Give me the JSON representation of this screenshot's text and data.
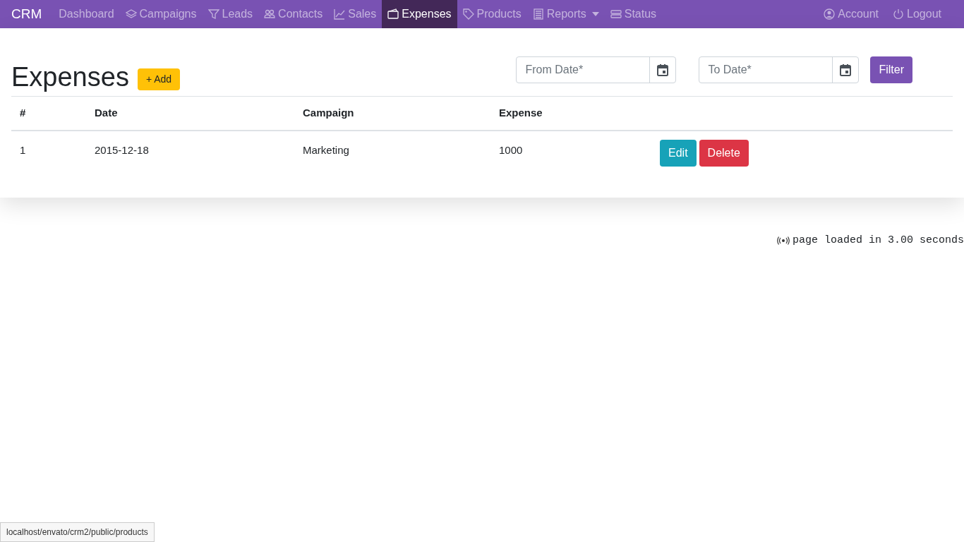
{
  "navbar": {
    "brand": "CRM",
    "items": [
      {
        "label": "Dashboard",
        "selected": false,
        "dropdown": false
      },
      {
        "label": "Campaigns",
        "selected": false,
        "dropdown": false
      },
      {
        "label": "Leads",
        "selected": false,
        "dropdown": false
      },
      {
        "label": "Contacts",
        "selected": false,
        "dropdown": false
      },
      {
        "label": "Sales",
        "selected": false,
        "dropdown": false
      },
      {
        "label": "Expenses",
        "selected": true,
        "dropdown": false
      },
      {
        "label": "Products",
        "selected": false,
        "dropdown": false
      },
      {
        "label": "Reports",
        "selected": false,
        "dropdown": true
      },
      {
        "label": "Status",
        "selected": false,
        "dropdown": false
      }
    ],
    "right_items": [
      {
        "label": "Account"
      },
      {
        "label": "Logout"
      }
    ]
  },
  "page": {
    "title": "Expenses",
    "add_button": "+ Add",
    "from_date": {
      "placeholder": "From Date*"
    },
    "to_date": {
      "placeholder": "To Date*"
    },
    "filter_button": "Filter"
  },
  "table": {
    "columns": [
      "#",
      "Date",
      "Campaign",
      "Expense"
    ],
    "rows": [
      {
        "cells": [
          "1",
          "2015-12-18",
          "Marketing",
          "1000"
        ],
        "actions": [
          "Edit",
          "Delete"
        ]
      }
    ]
  },
  "footer": {
    "load_time": "page loaded in 3.00 seconds"
  },
  "status_bar": {
    "url": "localhost/envato/crm2/public/products"
  }
}
